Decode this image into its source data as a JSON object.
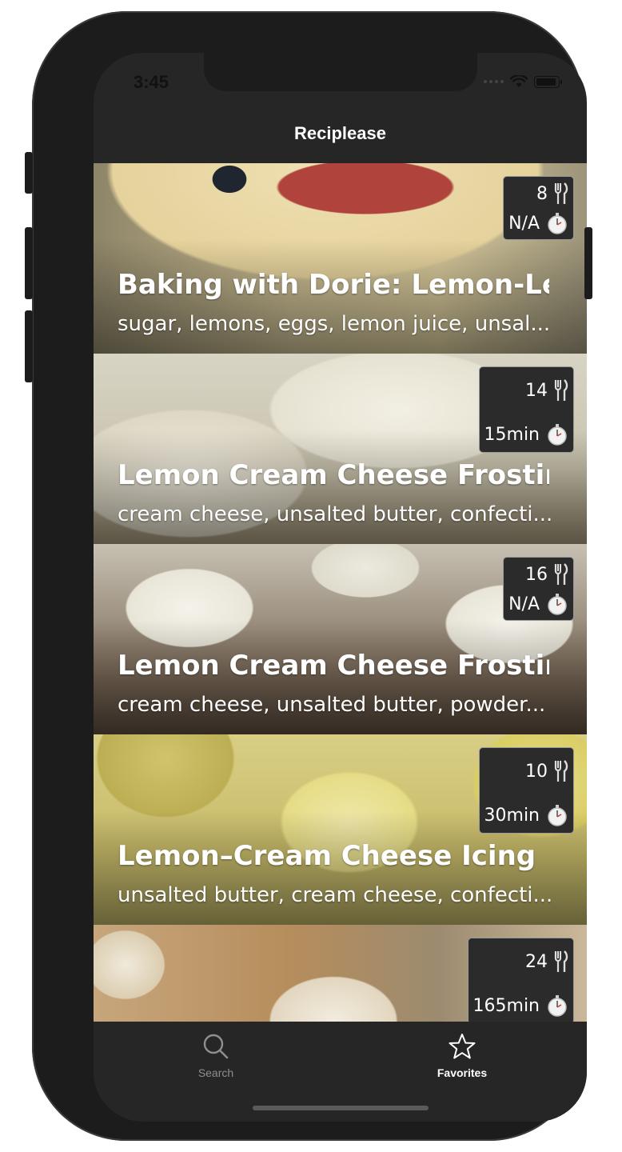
{
  "status_bar": {
    "time": "3:45"
  },
  "nav": {
    "title": "Reciplease"
  },
  "recipes": [
    {
      "title": "Baking with Dorie: Lemon-Le...",
      "ingredients": "sugar, lemons, eggs, lemon juice, unsal...",
      "servings": "8",
      "time": "N/A"
    },
    {
      "title": "Lemon Cream Cheese Frosting",
      "ingredients": "cream cheese, unsalted butter, confecti...",
      "servings": "14",
      "time": "15min"
    },
    {
      "title": "Lemon Cream Cheese Frosting",
      "ingredients": "cream cheese, unsalted butter, powder...",
      "servings": "16",
      "time": "N/A"
    },
    {
      "title": "Lemon–Cream Cheese Icing",
      "ingredients": "unsalted butter, cream cheese, confecti...",
      "servings": "10",
      "time": "30min"
    },
    {
      "title": "",
      "ingredients": "",
      "servings": "24",
      "time": "165min"
    }
  ],
  "icons": {
    "servings": "fork-knife-icon",
    "time": "stopwatch-icon",
    "search": "search-icon",
    "favorites": "star-icon"
  },
  "tabs": [
    {
      "label": "Search",
      "selected": false
    },
    {
      "label": "Favorites",
      "selected": true
    }
  ]
}
